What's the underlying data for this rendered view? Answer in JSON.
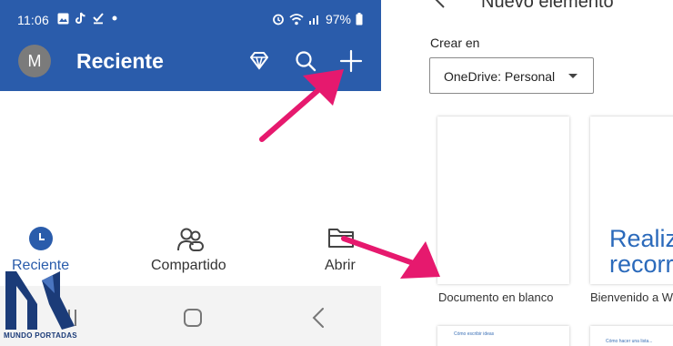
{
  "status_bar": {
    "time": "11:06",
    "battery_pct": "97%",
    "icons": [
      "image-icon",
      "tiktok-icon",
      "download-done-icon",
      "dot-icon",
      "alarm-icon",
      "wifi-icon",
      "signal-icon",
      "battery-icon"
    ]
  },
  "app_bar": {
    "avatar_letter": "M",
    "title": "Reciente",
    "actions": [
      "premium-diamond-icon",
      "search-icon",
      "add-icon"
    ]
  },
  "bottom_nav": {
    "items": [
      {
        "label": "Reciente",
        "icon": "clock-icon",
        "active": true
      },
      {
        "label": "Compartido",
        "icon": "people-icon",
        "active": false
      },
      {
        "label": "Abrir",
        "icon": "folder-icon",
        "active": false
      }
    ]
  },
  "system_nav": [
    "recents-icon",
    "home-icon",
    "back-icon"
  ],
  "new_item": {
    "title": "Nuevo elemento",
    "location_label": "Crear en",
    "location_value": "OneDrive: Personal",
    "templates": [
      {
        "caption": "Documento en blanco",
        "preview_text": ""
      },
      {
        "caption": "Bienvenido a W",
        "preview_text": "Realiza\nrecorric"
      }
    ],
    "small_card_texts": [
      "Cómo escribir ideas",
      "Cómo hacer una lista..."
    ]
  },
  "watermark": {
    "brand": "MUNDO PORTADAS"
  },
  "colors": {
    "app_bar": "#2a5cab",
    "accent_arrow": "#e6196e",
    "word_blue": "#2b6abb",
    "logo_navy": "#1b3b78"
  }
}
